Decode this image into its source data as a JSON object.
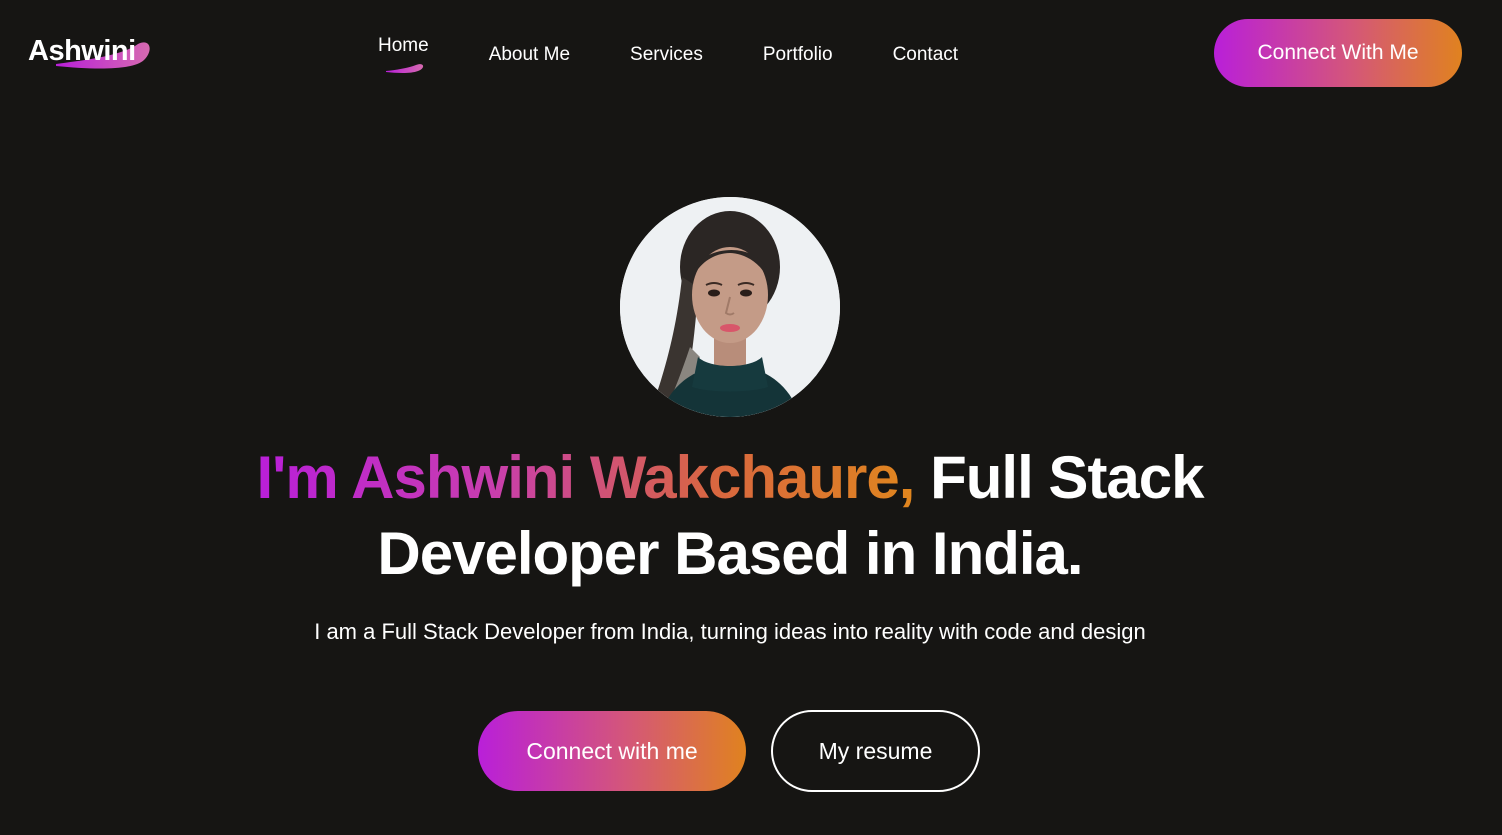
{
  "header": {
    "logo_text": "Ashwini",
    "nav": [
      {
        "label": "Home",
        "active": true
      },
      {
        "label": "About Me",
        "active": false
      },
      {
        "label": "Services",
        "active": false
      },
      {
        "label": "Portfolio",
        "active": false
      },
      {
        "label": "Contact",
        "active": false
      }
    ],
    "cta_label": "Connect With Me"
  },
  "hero": {
    "avatar_icon": "profile-photo",
    "headline_gradient": "I'm Ashwini Wakchaure,",
    "headline_plain_1": " Full Stack",
    "headline_plain_2": "Developer Based in India.",
    "subtitle": "I am a Full Stack Developer from India, turning ideas into reality with code and design",
    "primary_button": "Connect with me",
    "secondary_button": "My resume"
  },
  "colors": {
    "background": "#161513",
    "gradient_start": "#b91fd9",
    "gradient_end": "#e0821f",
    "text": "#ffffff"
  }
}
